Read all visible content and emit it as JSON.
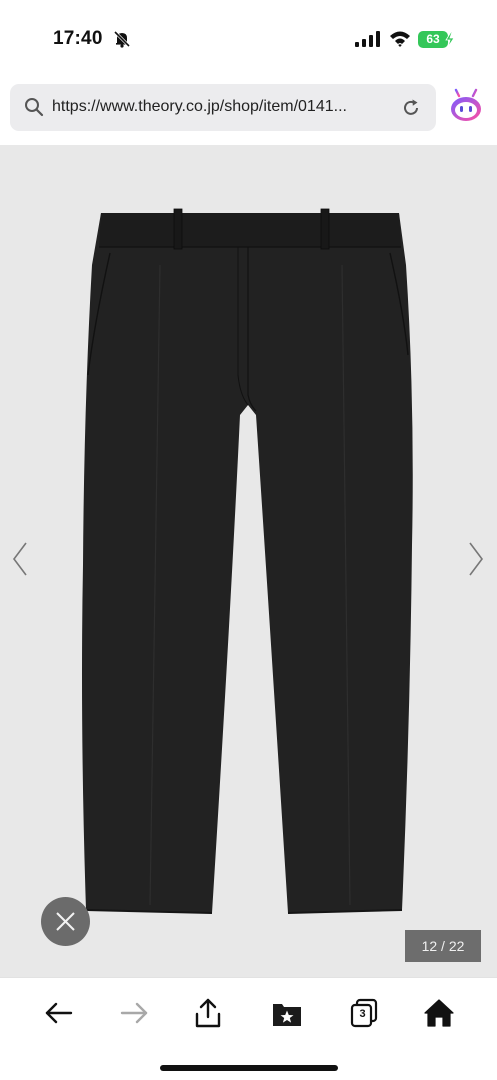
{
  "status_bar": {
    "time": "17:40",
    "battery_level": "63",
    "icons": [
      "bell-slash-icon",
      "cellular-signal-icon",
      "wifi-icon",
      "battery-charging-icon"
    ]
  },
  "browser": {
    "url": "https://www.theory.co.jp/shop/item/0141...",
    "icons": [
      "search-icon",
      "reload-icon",
      "assistant-icon"
    ]
  },
  "viewer": {
    "image_alt": "black cropped trousers",
    "page_counter": "12 / 22",
    "icons": [
      "chevron-left-icon",
      "chevron-right-icon",
      "close-icon"
    ]
  },
  "toolbar": {
    "tabs_count": "3",
    "icons": [
      "back-arrow-icon",
      "forward-arrow-icon",
      "share-icon",
      "bookmark-star-icon",
      "tabs-icon",
      "home-icon"
    ]
  },
  "colors": {
    "battery_green": "#34c759",
    "viewer_background": "#e8e8e8",
    "url_bar_background": "#ececee",
    "counter_background": "#6d6d6d",
    "forward_disabled": "#a8a8a8"
  }
}
